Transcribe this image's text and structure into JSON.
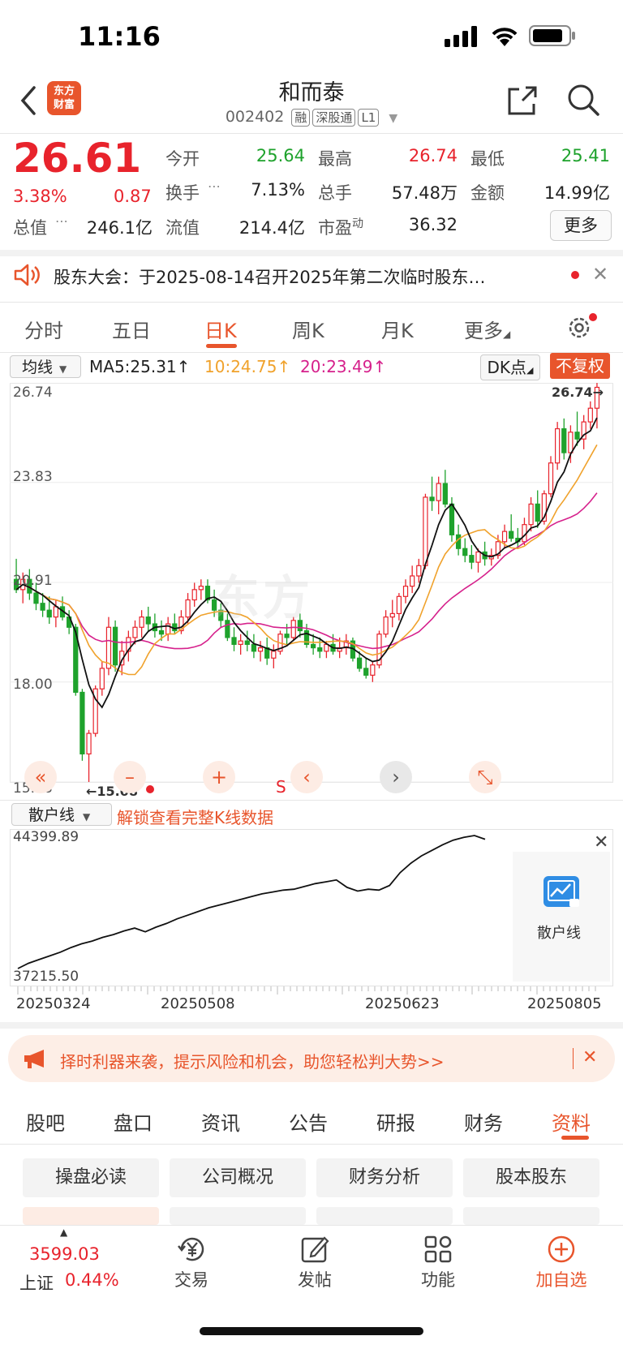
{
  "status_bar": {
    "time": "11:16"
  },
  "header": {
    "title": "和而泰",
    "code": "002402",
    "tags": [
      "融",
      "深股通",
      "L1"
    ],
    "logo_text": [
      "东方",
      "财富"
    ]
  },
  "quote": {
    "price": "26.61",
    "change_pct": "3.38%",
    "change": "0.87",
    "open_label": "今开",
    "open": "25.64",
    "high_label": "最高",
    "high": "26.74",
    "low_label": "最低",
    "low": "25.41",
    "turnover_label": "换手",
    "turnover": "7.13%",
    "volume_label": "总手",
    "volume": "57.48万",
    "amount_label": "金额",
    "amount": "14.99亿",
    "mktcap_label": "总值",
    "mktcap": "246.1亿",
    "float_label": "流值",
    "float": "214.4亿",
    "pe_label": "市盈",
    "pe_sup": "动",
    "pe": "36.32",
    "more_label": "更多"
  },
  "notice": {
    "text": "股东大会：于2025-08-14召开2025年第二次临时股东…"
  },
  "k_tabs": [
    {
      "label": "分时"
    },
    {
      "label": "五日"
    },
    {
      "label": "日K"
    },
    {
      "label": "周K"
    },
    {
      "label": "月K"
    },
    {
      "label": "更多"
    }
  ],
  "chart_header": {
    "ma_select": "均线",
    "ma5": "MA5:25.31↑",
    "ma10": "10:24.75↑",
    "ma20": "20:23.49↑",
    "dk": "DK点",
    "adjust": "不复权"
  },
  "chart_labels": {
    "y1": "26.74",
    "y2": "23.83",
    "y3": "20.91",
    "y4": "18.00",
    "y5": "15.08",
    "max_marker": "26.74→",
    "min_marker": "←15.08",
    "s_marker": "S"
  },
  "chart_data": {
    "type": "candlestick",
    "ylim": [
      15.08,
      26.74
    ],
    "y_ticks": [
      26.74,
      23.83,
      20.91,
      18.0,
      15.08
    ],
    "series": [
      {
        "name": "MA5",
        "value": 25.31,
        "color": "#111111"
      },
      {
        "name": "10",
        "value": 24.75,
        "color": "#f0a22c"
      },
      {
        "name": "20",
        "value": 23.49,
        "color": "#d6218c"
      }
    ],
    "ohlc": [
      [
        21.0,
        21.6,
        20.6,
        20.7
      ],
      [
        20.7,
        21.2,
        20.3,
        21.0
      ],
      [
        21.0,
        21.3,
        20.4,
        20.6
      ],
      [
        20.6,
        20.9,
        20.1,
        20.3
      ],
      [
        20.3,
        20.6,
        19.9,
        20.1
      ],
      [
        20.1,
        20.5,
        19.7,
        19.9
      ],
      [
        19.9,
        20.4,
        19.6,
        20.2
      ],
      [
        20.2,
        20.5,
        19.8,
        19.9
      ],
      [
        19.9,
        20.1,
        19.4,
        19.6
      ],
      [
        19.6,
        19.7,
        17.6,
        17.7
      ],
      [
        17.7,
        17.8,
        15.7,
        15.9
      ],
      [
        15.9,
        16.6,
        15.08,
        16.5
      ],
      [
        16.5,
        17.9,
        16.4,
        17.8
      ],
      [
        17.8,
        18.6,
        17.6,
        18.4
      ],
      [
        18.4,
        19.9,
        18.2,
        19.6
      ],
      [
        19.6,
        19.8,
        18.3,
        18.5
      ],
      [
        18.5,
        19.2,
        18.2,
        18.9
      ],
      [
        18.9,
        19.5,
        18.6,
        19.3
      ],
      [
        19.3,
        19.8,
        19.1,
        19.6
      ],
      [
        19.6,
        20.1,
        19.3,
        19.9
      ],
      [
        19.9,
        20.2,
        19.5,
        19.7
      ],
      [
        19.7,
        20.0,
        19.3,
        19.5
      ],
      [
        19.5,
        19.8,
        19.2,
        19.4
      ],
      [
        19.4,
        19.9,
        19.2,
        19.7
      ],
      [
        19.7,
        20.0,
        19.4,
        19.5
      ],
      [
        19.5,
        20.1,
        19.4,
        19.9
      ],
      [
        19.9,
        20.6,
        19.7,
        20.4
      ],
      [
        20.4,
        20.9,
        20.2,
        20.7
      ],
      [
        20.7,
        21.0,
        20.4,
        20.8
      ],
      [
        20.8,
        21.0,
        20.3,
        20.4
      ],
      [
        20.4,
        20.7,
        19.9,
        20.1
      ],
      [
        20.1,
        20.3,
        19.6,
        19.8
      ],
      [
        19.8,
        20.0,
        19.2,
        19.3
      ],
      [
        19.3,
        19.6,
        18.9,
        19.1
      ],
      [
        19.1,
        19.4,
        18.8,
        19.2
      ],
      [
        19.2,
        19.5,
        18.9,
        19.1
      ],
      [
        19.1,
        19.4,
        18.7,
        18.9
      ],
      [
        18.9,
        19.2,
        18.6,
        19.0
      ],
      [
        19.0,
        19.3,
        18.5,
        18.7
      ],
      [
        18.7,
        19.1,
        18.4,
        18.9
      ],
      [
        18.9,
        19.5,
        18.8,
        19.4
      ],
      [
        19.4,
        19.7,
        19.1,
        19.3
      ],
      [
        19.3,
        19.9,
        19.2,
        19.8
      ],
      [
        19.8,
        20.0,
        19.3,
        19.5
      ],
      [
        19.5,
        19.7,
        19.0,
        19.1
      ],
      [
        19.1,
        19.4,
        18.8,
        19.0
      ],
      [
        19.0,
        19.3,
        18.7,
        18.9
      ],
      [
        18.9,
        19.2,
        18.7,
        19.1
      ],
      [
        19.1,
        19.4,
        18.8,
        18.9
      ],
      [
        18.9,
        19.3,
        18.7,
        19.0
      ],
      [
        19.0,
        19.4,
        18.8,
        19.2
      ],
      [
        19.2,
        19.3,
        18.6,
        18.7
      ],
      [
        18.7,
        18.9,
        18.3,
        18.4
      ],
      [
        18.4,
        18.7,
        18.1,
        18.2
      ],
      [
        18.2,
        18.6,
        18.0,
        18.5
      ],
      [
        18.5,
        19.5,
        18.4,
        19.4
      ],
      [
        19.4,
        20.1,
        19.3,
        19.9
      ],
      [
        19.9,
        20.4,
        19.6,
        20.0
      ],
      [
        20.0,
        20.6,
        19.8,
        20.5
      ],
      [
        20.5,
        21.0,
        20.3,
        20.8
      ],
      [
        20.8,
        21.4,
        20.6,
        21.1
      ],
      [
        21.1,
        21.6,
        20.9,
        21.4
      ],
      [
        21.4,
        23.5,
        21.3,
        23.4
      ],
      [
        23.4,
        24.0,
        23.0,
        23.3
      ],
      [
        23.3,
        24.0,
        22.9,
        23.8
      ],
      [
        23.8,
        24.2,
        23.1,
        23.2
      ],
      [
        23.2,
        23.4,
        22.1,
        22.3
      ],
      [
        22.3,
        22.6,
        21.7,
        21.9
      ],
      [
        21.9,
        22.2,
        21.5,
        21.7
      ],
      [
        21.7,
        22.0,
        21.3,
        21.5
      ],
      [
        21.5,
        21.9,
        21.2,
        21.8
      ],
      [
        21.8,
        22.1,
        21.4,
        21.6
      ],
      [
        21.6,
        21.9,
        21.4,
        21.7
      ],
      [
        21.7,
        22.3,
        21.6,
        22.1
      ],
      [
        22.1,
        22.6,
        21.9,
        22.4
      ],
      [
        22.4,
        22.9,
        22.1,
        22.2
      ],
      [
        22.2,
        22.5,
        21.9,
        22.1
      ],
      [
        22.1,
        22.8,
        22.0,
        22.6
      ],
      [
        22.6,
        23.4,
        22.4,
        23.2
      ],
      [
        23.2,
        23.6,
        22.5,
        22.7
      ],
      [
        22.7,
        23.6,
        22.6,
        23.5
      ],
      [
        23.5,
        24.6,
        23.4,
        24.4
      ],
      [
        24.4,
        25.6,
        24.2,
        25.4
      ],
      [
        25.4,
        25.7,
        24.5,
        24.7
      ],
      [
        24.7,
        25.5,
        24.4,
        25.3
      ],
      [
        25.3,
        25.9,
        24.9,
        25.1
      ],
      [
        25.1,
        25.8,
        24.8,
        25.6
      ],
      [
        25.6,
        26.2,
        25.4,
        26.0
      ],
      [
        26.0,
        26.74,
        25.41,
        26.61
      ]
    ]
  },
  "chart_controls": [
    "«",
    "–",
    "+",
    "‹",
    "›",
    "⤡"
  ],
  "sanhu": {
    "select": "散户线",
    "unlock": "解锁查看完整K线数据",
    "y_top": "44399.89",
    "y_bottom": "37215.50",
    "card_label": "散户线",
    "dates": [
      "20250324",
      "20250508",
      "20250623",
      "20250805"
    ],
    "chart_data": {
      "type": "line",
      "ylim": [
        37215.5,
        44399.89
      ],
      "values": [
        37215.5,
        37500,
        37700,
        37900,
        38100,
        38350,
        38550,
        38700,
        38900,
        39050,
        39250,
        39400,
        39200,
        39450,
        39650,
        39900,
        40100,
        40300,
        40500,
        40650,
        40800,
        40950,
        41100,
        41250,
        41350,
        41450,
        41500,
        41650,
        41800,
        41900,
        42000,
        41600,
        41400,
        41500,
        41450,
        41700,
        42400,
        42900,
        43300,
        43600,
        43900,
        44150,
        44300,
        44399.89,
        44200
      ]
    }
  },
  "promo": {
    "text": "择时利器来袭，提示风险和机会，助您轻松判大势>>"
  },
  "bottom_tabs": [
    {
      "label": "股吧"
    },
    {
      "label": "盘口"
    },
    {
      "label": "资讯"
    },
    {
      "label": "公告"
    },
    {
      "label": "研报"
    },
    {
      "label": "财务"
    },
    {
      "label": "资料"
    }
  ],
  "grid_buttons": [
    {
      "label": "操盘必读"
    },
    {
      "label": "公司概况"
    },
    {
      "label": "财务分析"
    },
    {
      "label": "股本股东"
    }
  ],
  "navbar": {
    "index_value": "3599.03",
    "index_name": "上证",
    "index_change": "0.44%",
    "items": [
      {
        "label": "交易",
        "icon": "yen-icon"
      },
      {
        "label": "发帖",
        "icon": "edit-icon"
      },
      {
        "label": "功能",
        "icon": "grid-icon"
      },
      {
        "label": "加自选",
        "icon": "plus-circle-icon"
      }
    ]
  },
  "colors": {
    "up": "#e8232c",
    "down": "#1ea22c",
    "accent": "#e8552c"
  }
}
